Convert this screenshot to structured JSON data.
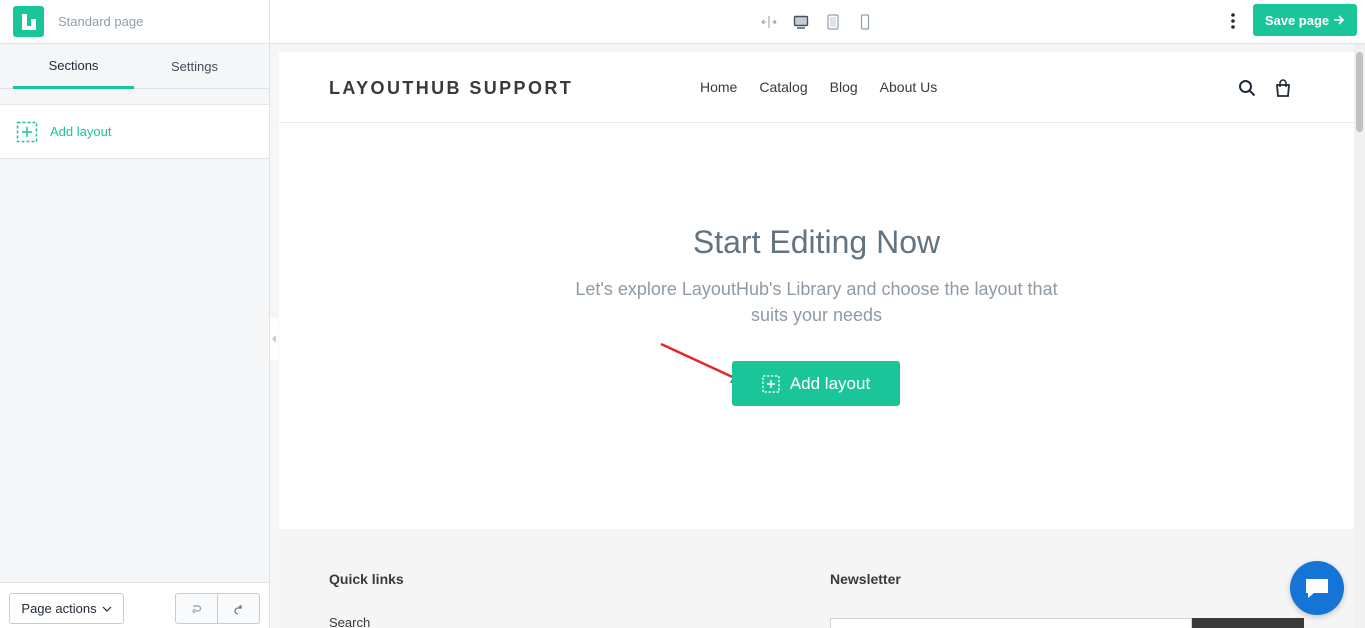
{
  "header": {
    "page_type": "Standard page",
    "save_label": "Save page",
    "device_icons": [
      "fullwidth-icon",
      "desktop-icon",
      "tablet-icon",
      "mobile-icon"
    ]
  },
  "sidebar": {
    "tabs": [
      {
        "label": "Sections",
        "active": true
      },
      {
        "label": "Settings",
        "active": false
      }
    ],
    "add_layout_label": "Add layout",
    "page_actions_label": "Page actions"
  },
  "store": {
    "title": "LAYOUTHUB SUPPORT",
    "nav": [
      "Home",
      "Catalog",
      "Blog",
      "About Us"
    ]
  },
  "hero": {
    "title": "Start Editing Now",
    "subtitle": "Let's explore LayoutHub's Library and choose the layout that suits your needs",
    "button_label": "Add layout"
  },
  "footer": {
    "quick_links_title": "Quick links",
    "newsletter_title": "Newsletter",
    "links": [
      "Search"
    ]
  },
  "colors": {
    "accent": "#1bc59a",
    "chat": "#1475d6",
    "arrow": "#e3262b"
  }
}
